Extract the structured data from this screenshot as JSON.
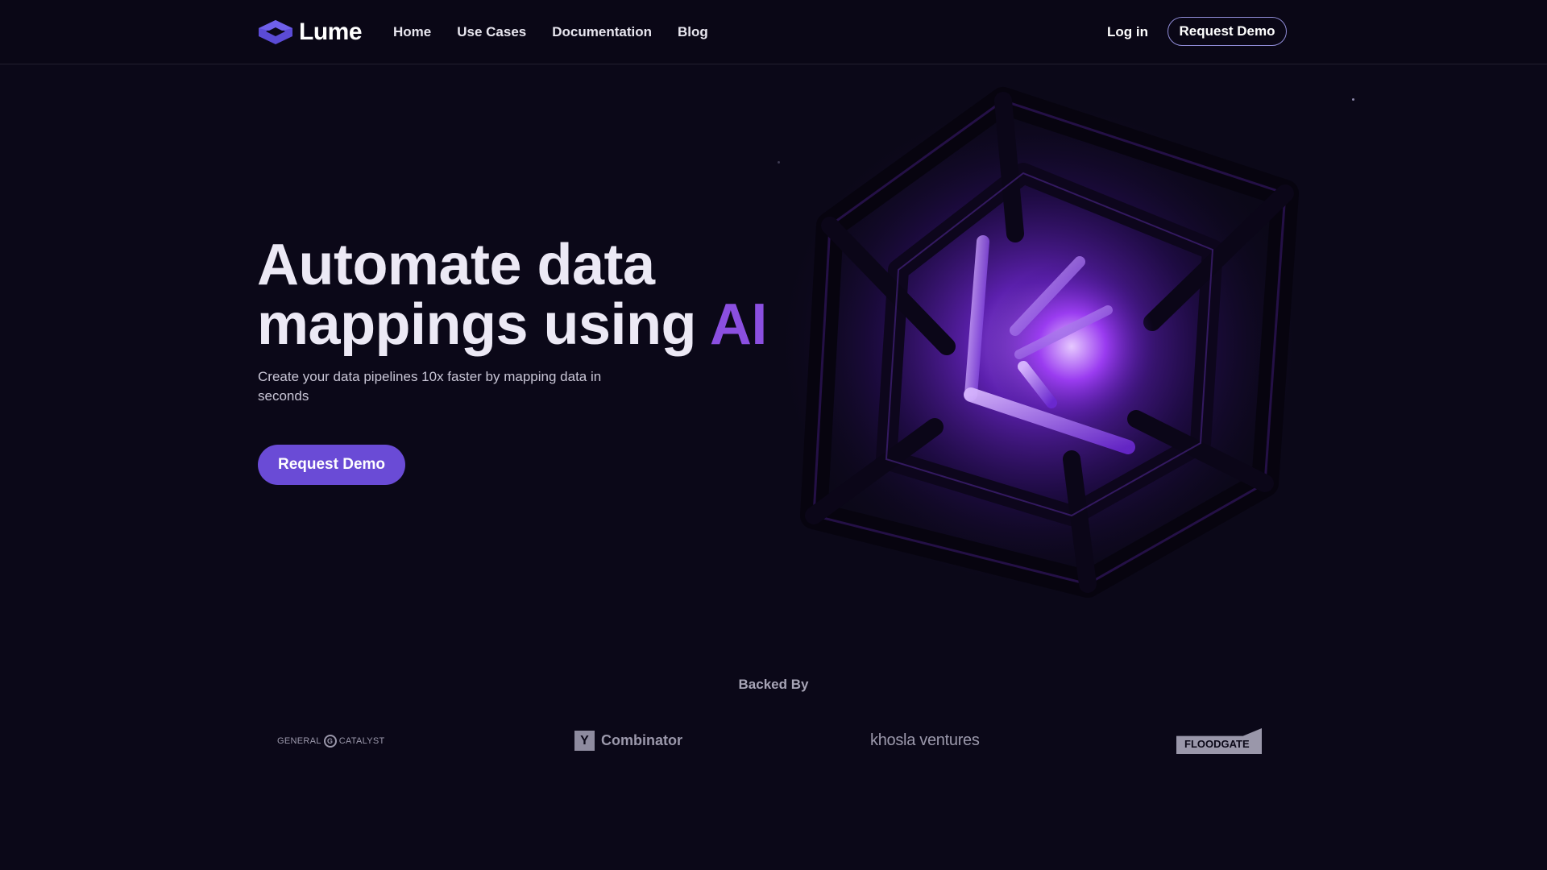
{
  "brand": {
    "name": "Lume",
    "logo_icon": "hexagon-cube-icon",
    "accent": "#5b4bd6"
  },
  "nav": {
    "links": [
      "Home",
      "Use Cases",
      "Documentation",
      "Blog"
    ],
    "login": "Log in",
    "cta": "Request Demo"
  },
  "hero": {
    "headline_line1": "Automate data",
    "headline_line2": "mappings using ",
    "headline_highlight": "AI",
    "subtitle": "Create your data pipelines 10x faster by mapping data in seconds",
    "cta": "Request Demo",
    "cta_color": "#6a4bd6",
    "highlight_color": "#8b4fe0"
  },
  "backers": {
    "label": "Backed By",
    "general_catalyst_left": "GENERAL",
    "general_catalyst_mark": "G",
    "general_catalyst_right": "CATALYST",
    "yc_mark": "Y",
    "yc_text": "Combinator",
    "khosla": "khosla ventures",
    "floodgate": "FLOODGATE"
  }
}
